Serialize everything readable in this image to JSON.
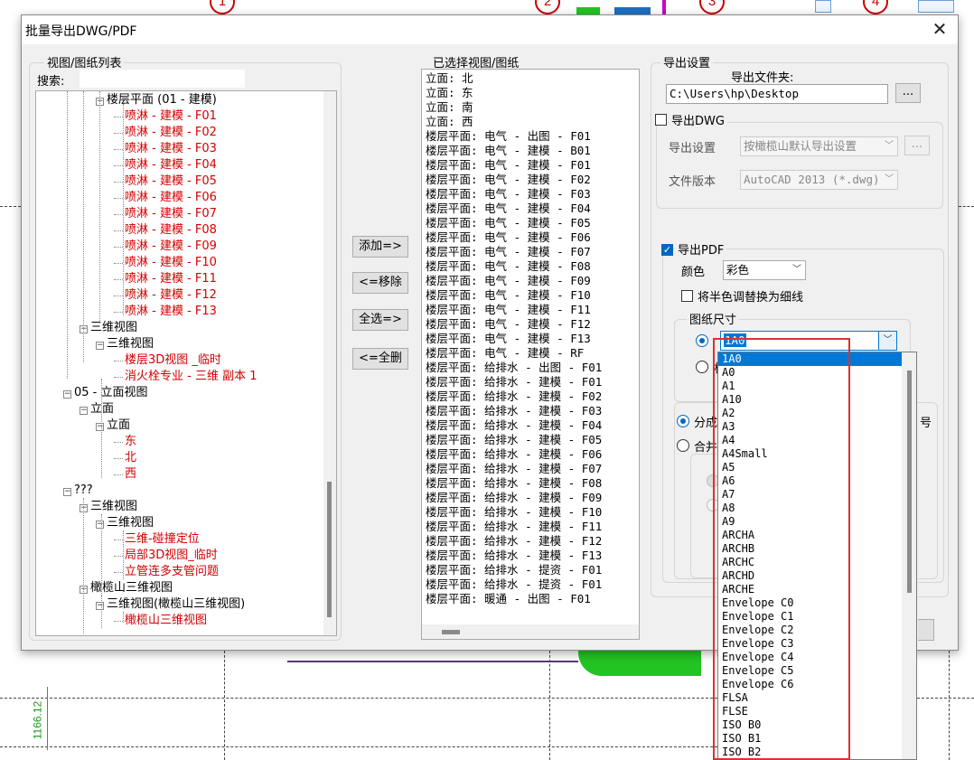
{
  "dialog": {
    "title": "批量导出DWG/PDF",
    "close_glyph": "✕"
  },
  "background": {
    "bubbles": [
      "1",
      "2",
      "3",
      "4"
    ],
    "dim_text": "1166.12",
    "colors": {
      "green": "#22c422",
      "blue": "#1f6fc0"
    }
  },
  "left_panel": {
    "group_label": "视图/图纸列表",
    "search_label": "搜索:",
    "search_value": "",
    "tree": [
      {
        "text": "楼层平面 (01 - 建模)",
        "level": 2,
        "red": false,
        "box": "−"
      },
      {
        "text": "喷淋 - 建模 - F01",
        "level": 3,
        "red": true
      },
      {
        "text": "喷淋 - 建模 - F02",
        "level": 3,
        "red": true
      },
      {
        "text": "喷淋 - 建模 - F03",
        "level": 3,
        "red": true
      },
      {
        "text": "喷淋 - 建模 - F04",
        "level": 3,
        "red": true
      },
      {
        "text": "喷淋 - 建模 - F05",
        "level": 3,
        "red": true
      },
      {
        "text": "喷淋 - 建模 - F06",
        "level": 3,
        "red": true
      },
      {
        "text": "喷淋 - 建模 - F07",
        "level": 3,
        "red": true
      },
      {
        "text": "喷淋 - 建模 - F08",
        "level": 3,
        "red": true
      },
      {
        "text": "喷淋 - 建模 - F09",
        "level": 3,
        "red": true
      },
      {
        "text": "喷淋 - 建模 - F10",
        "level": 3,
        "red": true
      },
      {
        "text": "喷淋 - 建模 - F11",
        "level": 3,
        "red": true
      },
      {
        "text": "喷淋 - 建模 - F12",
        "level": 3,
        "red": true
      },
      {
        "text": "喷淋 - 建模 - F13",
        "level": 3,
        "red": true
      },
      {
        "text": "三维视图",
        "level": 1,
        "red": false,
        "box": "−"
      },
      {
        "text": "三维视图",
        "level": 2,
        "red": false,
        "box": "−"
      },
      {
        "text": "楼层3D视图 _临时",
        "level": 3,
        "red": true
      },
      {
        "text": "消火栓专业 - 三维 副本 1",
        "level": 3,
        "red": true
      },
      {
        "text": "05 - 立面视图",
        "level": 0,
        "red": false,
        "box": "−"
      },
      {
        "text": "立面",
        "level": 1,
        "red": false,
        "box": "−"
      },
      {
        "text": "立面",
        "level": 2,
        "red": false,
        "box": "−"
      },
      {
        "text": "东",
        "level": 3,
        "red": true
      },
      {
        "text": "北",
        "level": 3,
        "red": true
      },
      {
        "text": "西",
        "level": 3,
        "red": true
      },
      {
        "text": "???",
        "level": 0,
        "red": false,
        "box": "−"
      },
      {
        "text": "三维视图",
        "level": 1,
        "red": false,
        "box": "−"
      },
      {
        "text": "三维视图",
        "level": 2,
        "red": false,
        "box": "−"
      },
      {
        "text": "三维-碰撞定位",
        "level": 3,
        "red": true
      },
      {
        "text": "局部3D视图_临时",
        "level": 3,
        "red": true
      },
      {
        "text": "立管连多支管问题",
        "level": 3,
        "red": true
      },
      {
        "text": "橄榄山三维视图",
        "level": 1,
        "red": false,
        "box": "−"
      },
      {
        "text": "三维视图(橄榄山三维视图)",
        "level": 2,
        "red": false,
        "box": "−"
      },
      {
        "text": "橄榄山三维视图",
        "level": 3,
        "red": true
      }
    ]
  },
  "buttons": {
    "add": "添加=>",
    "remove": "<=移除",
    "select_all": "全选=>",
    "delete_all": "<=全删"
  },
  "middle_panel": {
    "group_label": "已选择视图/图纸",
    "items": [
      "立面: 北",
      "立面: 东",
      "立面: 南",
      "立面: 西",
      "楼层平面: 电气 - 出图 - F01",
      "楼层平面: 电气 - 建模 - B01",
      "楼层平面: 电气 - 建模 - F01",
      "楼层平面: 电气 - 建模 - F02",
      "楼层平面: 电气 - 建模 - F03",
      "楼层平面: 电气 - 建模 - F04",
      "楼层平面: 电气 - 建模 - F05",
      "楼层平面: 电气 - 建模 - F06",
      "楼层平面: 电气 - 建模 - F07",
      "楼层平面: 电气 - 建模 - F08",
      "楼层平面: 电气 - 建模 - F09",
      "楼层平面: 电气 - 建模 - F10",
      "楼层平面: 电气 - 建模 - F11",
      "楼层平面: 电气 - 建模 - F12",
      "楼层平面: 电气 - 建模 - F13",
      "楼层平面: 电气 - 建模 - RF",
      "楼层平面: 给排水 - 出图 - F01",
      "楼层平面: 给排水 - 建模 - F01",
      "楼层平面: 给排水 - 建模 - F02",
      "楼层平面: 给排水 - 建模 - F03",
      "楼层平面: 给排水 - 建模 - F04",
      "楼层平面: 给排水 - 建模 - F05",
      "楼层平面: 给排水 - 建模 - F06",
      "楼层平面: 给排水 - 建模 - F07",
      "楼层平面: 给排水 - 建模 - F08",
      "楼层平面: 给排水 - 建模 - F09",
      "楼层平面: 给排水 - 建模 - F10",
      "楼层平面: 给排水 - 建模 - F11",
      "楼层平面: 给排水 - 建模 - F12",
      "楼层平面: 给排水 - 建模 - F13",
      "楼层平面: 给排水 - 提资 - F01",
      "楼层平面: 给排水 - 提资 - F01",
      "楼层平面: 暖通 - 出图 - F01"
    ]
  },
  "settings": {
    "group_label": "导出设置",
    "folder_label": "导出文件夹:",
    "folder_value": "C:\\Users\\hp\\Desktop",
    "browse_label": "...",
    "dwg": {
      "label": "导出DWG",
      "checked": false,
      "setting_label": "导出设置",
      "setting_value": "按橄榄山默认导出设置",
      "version_label": "文件版本",
      "version_value": "AutoCAD 2013 (*.dwg)",
      "more_label": "..."
    },
    "pdf": {
      "label": "导出PDF",
      "checked": true,
      "color_label": "颜色",
      "color_value": "彩色",
      "halftone_label": "将半色调替换为细线",
      "paper_group_label": "图纸尺寸",
      "paper_value": "1A0",
      "option_a_label": "分成",
      "option_b_label": "合并",
      "partial_char": "相",
      "trailing_text": "号"
    }
  },
  "dropdown": {
    "items": [
      "1A0",
      "A0",
      "A1",
      "A10",
      "A2",
      "A3",
      "A4",
      "A4Small",
      "A5",
      "A6",
      "A7",
      "A8",
      "A9",
      "ARCHA",
      "ARCHB",
      "ARCHC",
      "ARCHD",
      "ARCHE",
      "Envelope C0",
      "Envelope C1",
      "Envelope C2",
      "Envelope C3",
      "Envelope C4",
      "Envelope C5",
      "Envelope C6",
      "FLSA",
      "FLSE",
      "ISO B0",
      "ISO B1",
      "ISO B2"
    ],
    "selected_index": 0,
    "highlight_color": "#e03030"
  }
}
